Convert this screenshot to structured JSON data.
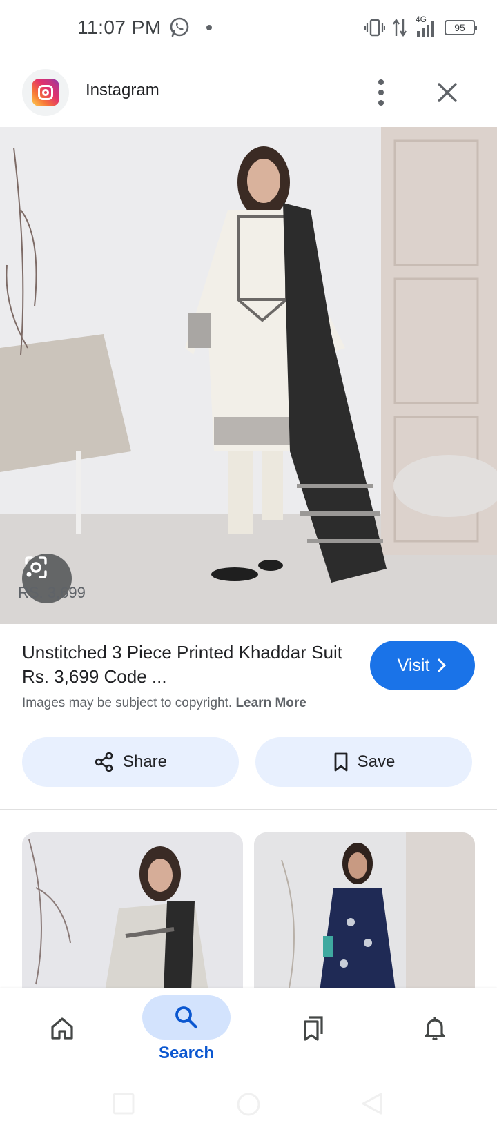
{
  "status_bar": {
    "time": "11:07 PM",
    "network": "4G",
    "battery": "95",
    "icons": [
      "whatsapp-icon",
      "notification-dot-icon",
      "vibrate-icon",
      "data-arrows-icon",
      "signal-icon",
      "battery-icon"
    ]
  },
  "header": {
    "app_name": "Instagram",
    "icons": [
      "instagram-logo-icon",
      "more-vert-icon",
      "close-icon"
    ]
  },
  "image": {
    "price_overlay": "RS. 3,699",
    "lens_icon": "google-lens-icon"
  },
  "result": {
    "title": "Unstitched 3 Piece Printed Khaddar Suit Rs. 3,699 Code ...",
    "visit_label": "Visit",
    "copyright_text": "Images may be subject to copyright.",
    "learn_more": "Learn More"
  },
  "actions": {
    "share_label": "Share",
    "save_label": "Save"
  },
  "bottom_nav": {
    "search_label": "Search",
    "items": [
      "home-icon",
      "search-icon",
      "collections-icon",
      "notifications-icon"
    ],
    "active": "search"
  },
  "colors": {
    "accent": "#1a73e8",
    "pill": "#e8f0fe",
    "nav_active": "#d3e3fd",
    "nav_label": "#0b57d0"
  }
}
